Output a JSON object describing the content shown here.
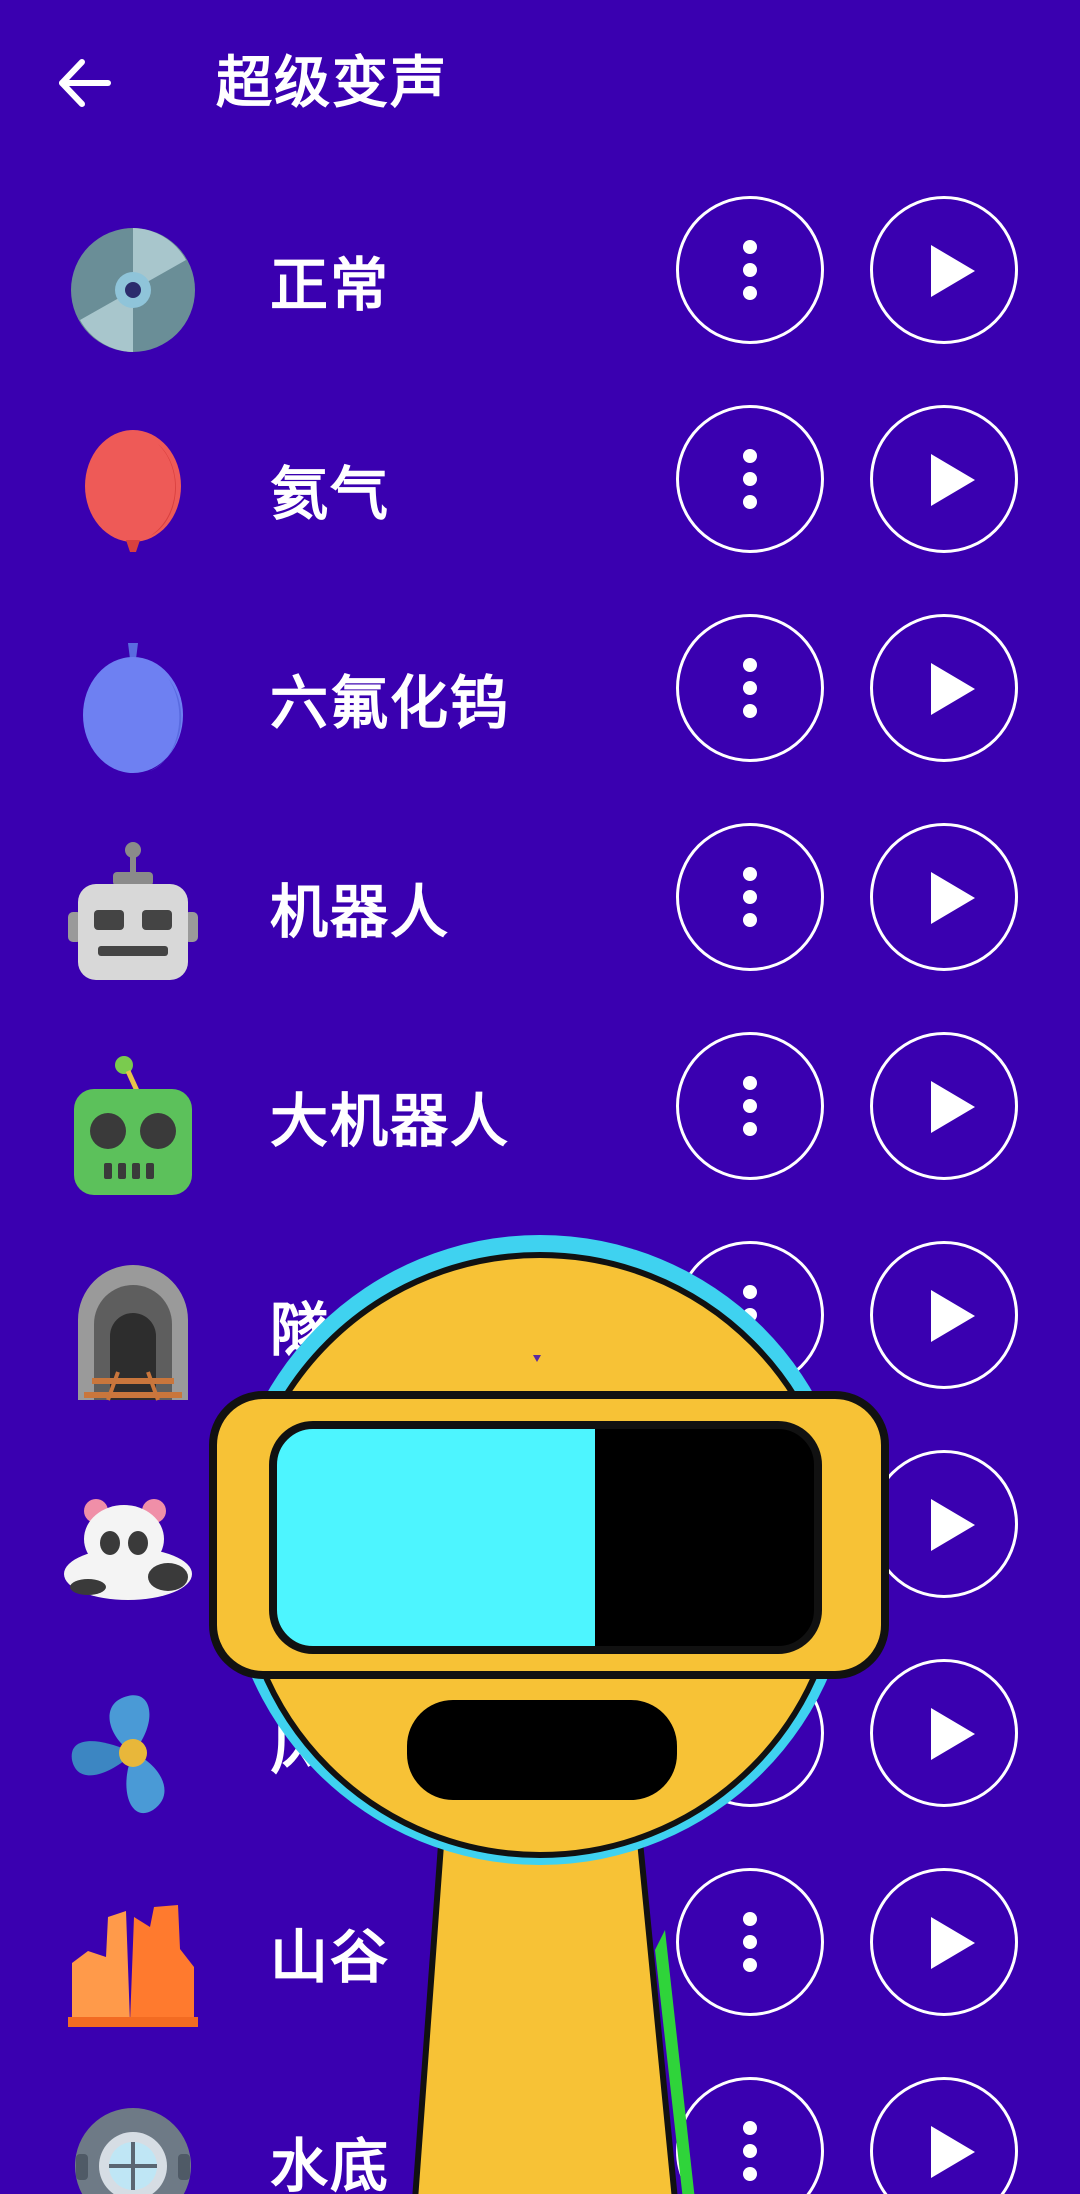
{
  "header": {
    "title": "超级变声",
    "back_icon": "arrow-left-icon"
  },
  "colors": {
    "background": "#3A00B0",
    "foreground": "#FFFFFF",
    "mascot_yellow": "#F7C236",
    "mascot_cyan": "#4DF5FF"
  },
  "effects": [
    {
      "label": "正常",
      "icon": "disc-icon"
    },
    {
      "label": "氦气",
      "icon": "red-balloon-icon"
    },
    {
      "label": "六氟化钨",
      "icon": "blue-balloon-icon"
    },
    {
      "label": "机器人",
      "icon": "robot-icon"
    },
    {
      "label": "大机器人",
      "icon": "green-robot-icon"
    },
    {
      "label": "隧",
      "icon": "tunnel-icon"
    },
    {
      "label": "",
      "icon": "panda-icon"
    },
    {
      "label": "风",
      "icon": "fan-icon"
    },
    {
      "label": "山谷",
      "icon": "canyon-icon"
    },
    {
      "label": "水底",
      "icon": "diving-helmet-icon"
    }
  ],
  "buttons": {
    "more_icon": "more-vertical-icon",
    "play_icon": "play-icon"
  },
  "overlay": {
    "icon": "mascot-character-icon"
  }
}
